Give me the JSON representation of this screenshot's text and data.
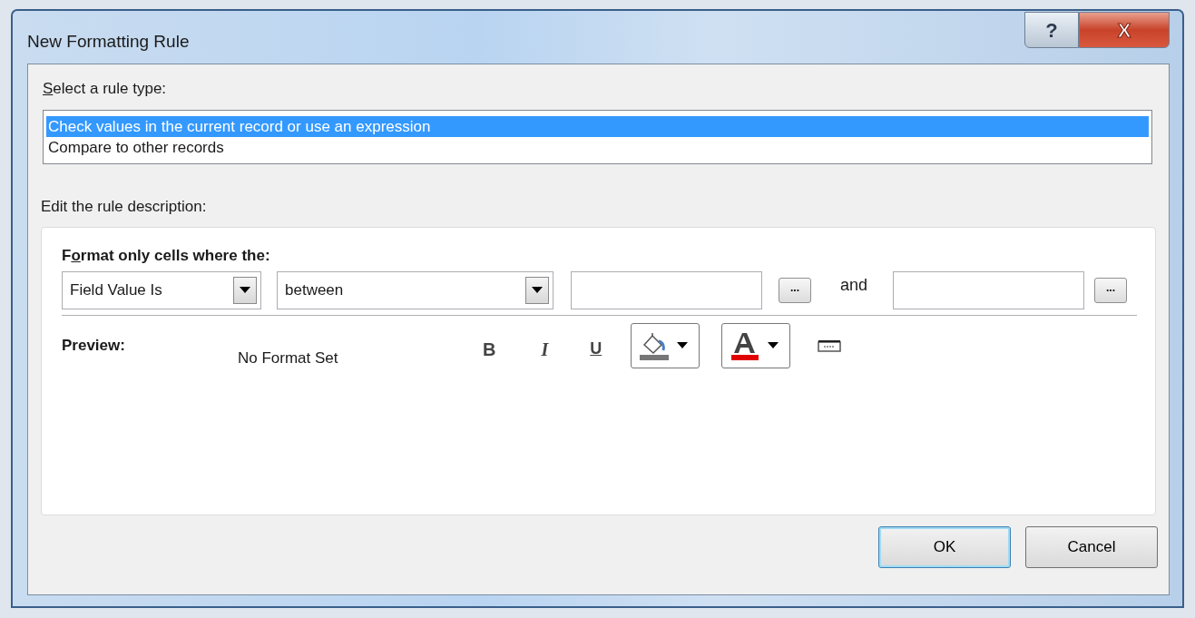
{
  "window": {
    "title": "New Formatting Rule",
    "buttons": [
      {
        "kind": "help",
        "label": "?"
      },
      {
        "kind": "close",
        "label": "X"
      }
    ]
  },
  "rule_type": {
    "label_parts": [
      {
        "text": "S",
        "underlined": true
      },
      {
        "text": "elect a rule type:",
        "underlined": false
      }
    ],
    "items": [
      {
        "label": "Check values in the current record or use an expression",
        "selected": true
      },
      {
        "label": "Compare to other records",
        "selected": false
      }
    ]
  },
  "description": {
    "label": "Edit the rule description:",
    "condition_label_parts": [
      {
        "text": "F",
        "underlined": false
      },
      {
        "text": "o",
        "underlined": true
      },
      {
        "text": "rmat only cells where the:",
        "underlined": false
      }
    ],
    "field_combo": {
      "value": "Field Value Is"
    },
    "operator_combo": {
      "value": "between"
    },
    "value1_button": "...",
    "and_label": "and",
    "value2_button": "...",
    "preview_label": "Preview:",
    "preview_text": "No Format Set",
    "format_buttons": [
      {
        "kind": "bold",
        "label": "B"
      },
      {
        "kind": "italic",
        "label": "I"
      },
      {
        "kind": "underline",
        "label": "U"
      },
      {
        "kind": "fill"
      },
      {
        "kind": "font_color"
      },
      {
        "kind": "format"
      }
    ]
  },
  "buttons": [
    {
      "label": "OK",
      "default": true
    },
    {
      "label": "Cancel",
      "default": false
    }
  ]
}
